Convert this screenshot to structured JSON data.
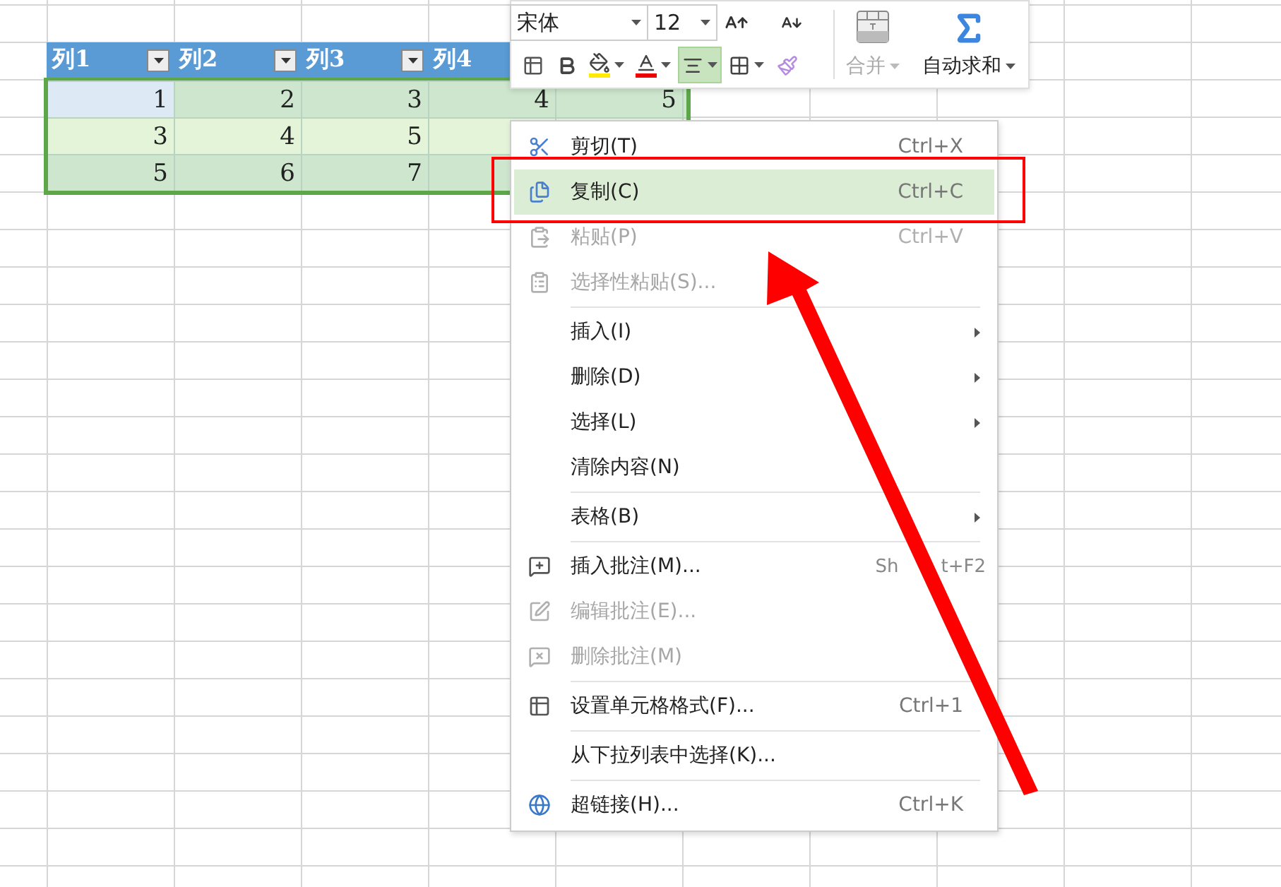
{
  "table": {
    "headers": [
      "列1",
      "列2",
      "列3"
    ],
    "covered_header": "列4",
    "rows": [
      {
        "cells": [
          {
            "text": "1",
            "active": true
          },
          {
            "text": "2",
            "active": false
          },
          {
            "text": "3",
            "active": false
          },
          {
            "text": "4",
            "active": false
          },
          {
            "text": "5",
            "active": false
          }
        ]
      },
      {
        "cells": [
          {
            "text": "3",
            "active": false
          },
          {
            "text": "4",
            "active": false
          },
          {
            "text": "5",
            "active": false
          }
        ]
      },
      {
        "cells": [
          {
            "text": "5",
            "active": false
          },
          {
            "text": "6",
            "active": false
          },
          {
            "text": "7",
            "active": false
          }
        ]
      }
    ]
  },
  "toolbar": {
    "font": "宋体",
    "size": "12",
    "align_center": {
      "selected": true
    },
    "merge": {
      "label": "合并",
      "disabled": true
    },
    "autosum": {
      "label": "自动求和"
    }
  },
  "context_menu": [
    {
      "kind": "item",
      "label": "剪切(T)",
      "shortcut": "Ctrl+X",
      "disabled": false,
      "selected": false,
      "submenu": false
    },
    {
      "kind": "item",
      "label": "复制(C)",
      "shortcut": "Ctrl+C",
      "disabled": false,
      "selected": true,
      "submenu": false
    },
    {
      "kind": "item",
      "label": "粘贴(P)",
      "shortcut": "Ctrl+V",
      "disabled": true,
      "selected": false,
      "submenu": false
    },
    {
      "kind": "item",
      "label": "选择性粘贴(S)...",
      "disabled": true,
      "selected": false,
      "submenu": false
    },
    {
      "kind": "separator"
    },
    {
      "kind": "item",
      "label": "插入(I)",
      "disabled": false,
      "selected": false,
      "submenu": true
    },
    {
      "kind": "item",
      "label": "删除(D)",
      "disabled": false,
      "selected": false,
      "submenu": true
    },
    {
      "kind": "item",
      "label": "选择(L)",
      "disabled": false,
      "selected": false,
      "submenu": true
    },
    {
      "kind": "item",
      "label": "清除内容(N)",
      "disabled": false,
      "selected": false,
      "submenu": false
    },
    {
      "kind": "separator"
    },
    {
      "kind": "item",
      "label": "表格(B)",
      "disabled": false,
      "selected": false,
      "submenu": true
    },
    {
      "kind": "separator"
    },
    {
      "kind": "item",
      "label": "插入批注(M)...",
      "shortcut_parts": [
        "Sh",
        "t+F2"
      ],
      "disabled": false,
      "selected": false,
      "submenu": false
    },
    {
      "kind": "item",
      "label": "编辑批注(E)...",
      "disabled": true,
      "selected": false,
      "submenu": false
    },
    {
      "kind": "item",
      "label": "删除批注(M)",
      "disabled": true,
      "selected": false,
      "submenu": false
    },
    {
      "kind": "separator"
    },
    {
      "kind": "item",
      "label": "设置单元格格式(F)...",
      "shortcut": "Ctrl+1",
      "disabled": false,
      "selected": false,
      "submenu": false
    },
    {
      "kind": "separator"
    },
    {
      "kind": "item",
      "label": "从下拉列表中选择(K)...",
      "disabled": false,
      "selected": false,
      "submenu": false
    },
    {
      "kind": "separator"
    },
    {
      "kind": "item",
      "label": "超链接(H)...",
      "shortcut": "Ctrl+K",
      "disabled": false,
      "selected": false,
      "submenu": false
    }
  ]
}
